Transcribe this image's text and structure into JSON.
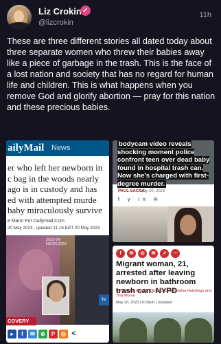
{
  "header": {
    "name": "Liz Crokin",
    "verified_glyph": "✓",
    "handle": "@lizcrokin",
    "time": "11h"
  },
  "post": {
    "text": "These are three different stories all dated today about three separate women who threw their babies away like a piece of garbage in the trash. This is the face of a lost nation and society that has no regard for human life and children. This is what happens when you remove God and glorify abortion — pray for this nation and these precious babies."
  },
  "card_dailymail": {
    "logo": "ailyMail",
    "section": "News",
    "headline_lines": [
      "er who left her newborn in",
      "c bag in the woods nearly",
      " ago is in custody and has",
      "ed with attempted murde",
      "baby miraculously survive"
    ],
    "byline_1": "e Mann For Dailymail.Com",
    "byline_2": "20 May 2023 , updated 21:16 EDT 20 May 2023",
    "watermark_line1": "2023-04-",
    "watermark_line2": "NEON 2023",
    "recovery_label": "COVERY",
    "share_icons": [
      "▸",
      "f",
      "✉",
      "⊕",
      "P",
      "◎",
      "<"
    ]
  },
  "card_nbc": {
    "headline": "bodycam video reveals shocking moment police confront teen over dead baby found in hospital trash can. Now she's charged with first-degree murder.",
    "author": "PAUL SACCA",
    "date": "May 20, 2023",
    "social": "f y in ✉"
  },
  "card_nypost": {
    "icons": [
      "f",
      "✉",
      "◎",
      "✉",
      "↗",
      "⋯"
    ],
    "headline": "Migrant woman, 21, arrested after leaving newborn in bathroom trash can: NYPD",
    "byline": "By Georgia Worrell, Larry Celona, Kristina Hutchings and Tina Moore",
    "date": "May 20, 2023 | 6:18pm | Updated"
  },
  "colors": {
    "background": "#15131f",
    "verified": "#e0457b",
    "dailymail_blue": "#005689",
    "nypost_red": "#b01e2e"
  }
}
